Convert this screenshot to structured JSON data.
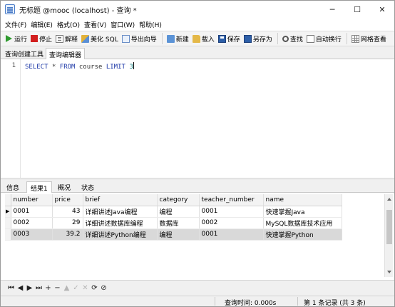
{
  "window": {
    "title": "无标题 @mooc (localhost) - 查询 *",
    "minimize": "─",
    "maximize": "☐",
    "close": "✕"
  },
  "menu": [
    "文件(F)",
    "编辑(E)",
    "格式(O)",
    "查看(V)",
    "窗口(W)",
    "帮助(H)"
  ],
  "toolbar": {
    "run": "运行",
    "stop": "停止",
    "explain": "解释",
    "beautify": "美化 SQL",
    "export_wizard": "导出向导",
    "new": "新建",
    "load": "载入",
    "save": "保存",
    "save_as": "另存为",
    "find": "查找",
    "word_wrap": "自动换行",
    "grid_view": "网格查看"
  },
  "top_tabs": {
    "builder": "查询创建工具",
    "editor": "查询编辑器"
  },
  "editor": {
    "line_number": "1",
    "kw_select": "SELECT",
    "star": "*",
    "kw_from": "FROM",
    "table": "course",
    "kw_limit": "LIMIT",
    "limit_value": "3"
  },
  "result_tabs": {
    "info": "信息",
    "result1": "结果1",
    "overview": "概况",
    "status": "状态"
  },
  "table": {
    "columns": [
      "number",
      "price",
      "brief",
      "category",
      "teacher_number",
      "name"
    ],
    "rows": [
      [
        "0001",
        "43",
        "详细讲述Java编程",
        "编程",
        "0001",
        "快速掌握Java"
      ],
      [
        "0002",
        "29",
        "详细讲述数据库编程",
        "数据库",
        "0002",
        "MySQL数据库技术应用"
      ],
      [
        "0003",
        "39.2",
        "详细讲述Python编程",
        "编程",
        "0001",
        "快速掌握Python"
      ]
    ],
    "current_row_marker": "▶"
  },
  "nav": {
    "first": "⏮",
    "prev": "◀",
    "next": "▶",
    "last": "⏭",
    "add": "+",
    "delete": "−",
    "edit": "▲",
    "apply": "✓",
    "cancel": "✕",
    "refresh": "⟳",
    "stop": "⊘"
  },
  "status": {
    "query_time": "查询时间: 0.000s",
    "records": "第 1 条记录 (共 3 条)"
  }
}
